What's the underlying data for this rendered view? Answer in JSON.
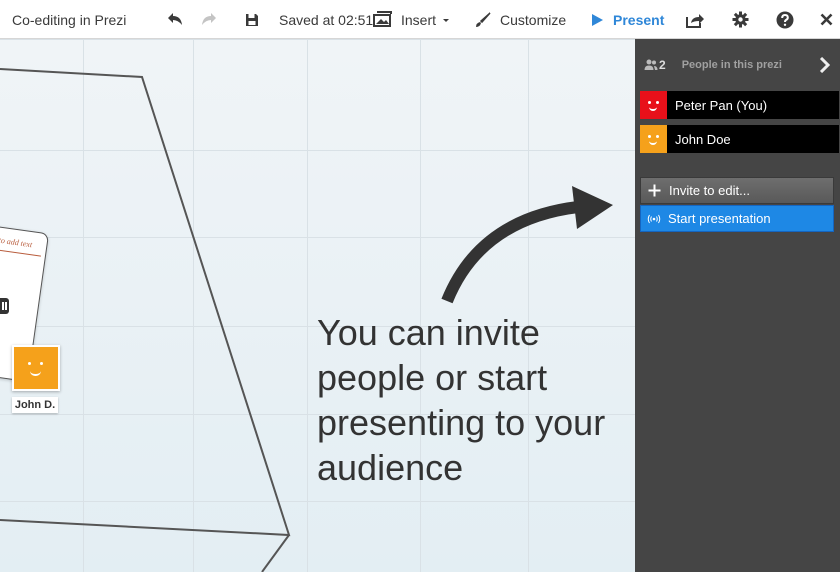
{
  "header": {
    "title": "Co-editing in Prezi",
    "saved": "Saved at 02:51",
    "insert_label": "Insert",
    "customize_label": "Customize",
    "present_label": "Present"
  },
  "canvas": {
    "headline": "You can invite people or start presenting to your audience",
    "text_box_placeholder": "to add text",
    "cursor_user_label": "John D."
  },
  "panel": {
    "count": "2",
    "heading": "People in this prezi",
    "people": [
      {
        "name": "Peter Pan (You)",
        "color": "#e8101a"
      },
      {
        "name": "John Doe",
        "color": "#f5a11b"
      }
    ],
    "invite_label": "Invite to edit...",
    "start_label": "Start presentation"
  },
  "colors": {
    "accent": "#2f87d8",
    "panel_bg": "#454545",
    "start_button": "#1e88e5"
  }
}
